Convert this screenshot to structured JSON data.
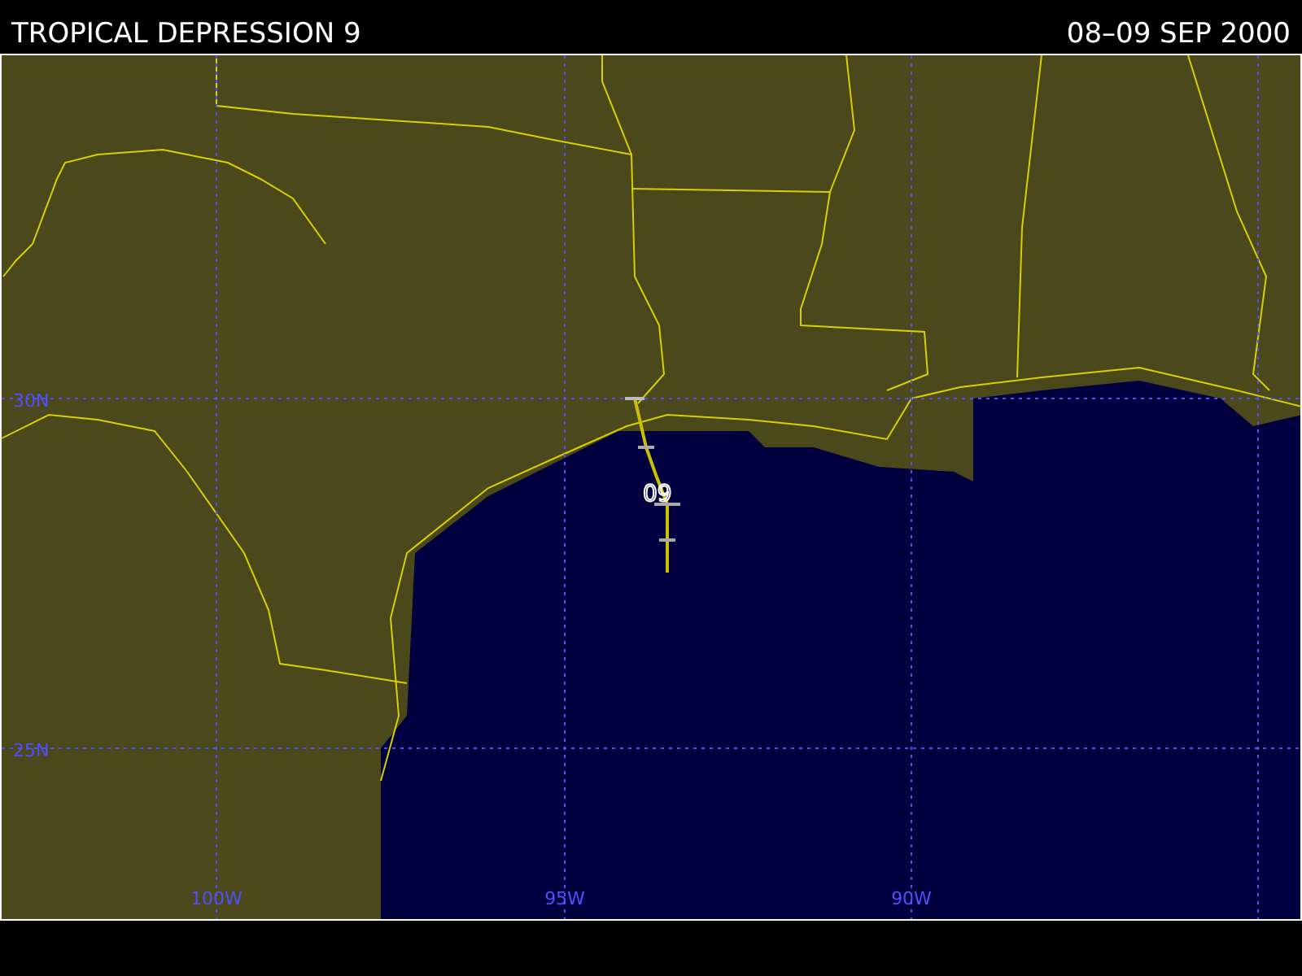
{
  "header": {
    "title": "TROPICAL DEPRESSION 9",
    "date": "08–09 SEP 2000"
  },
  "map": {
    "lat_labels": [
      "30N",
      "25N"
    ],
    "lon_labels": [
      "100W",
      "95W",
      "90W"
    ],
    "storm_label": "09"
  }
}
